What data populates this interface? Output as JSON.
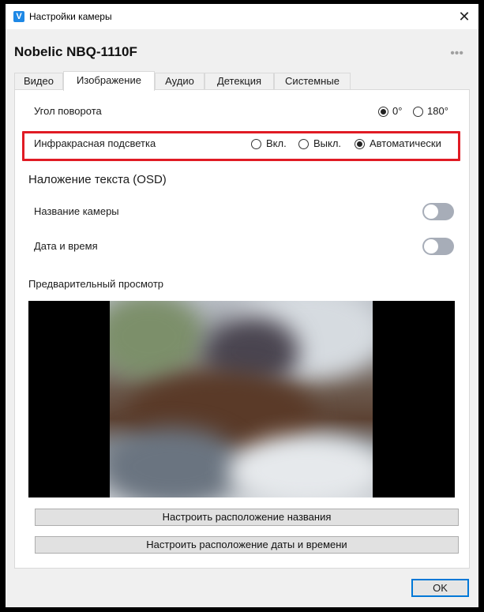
{
  "window": {
    "app_icon": "V",
    "title": "Настройки камеры",
    "close": "✕"
  },
  "device": {
    "name": "Nobelic NBQ-1110F",
    "more": "•••"
  },
  "tabs": [
    {
      "label": "Видео",
      "active": false
    },
    {
      "label": "Изображение",
      "active": true
    },
    {
      "label": "Аудио",
      "active": false
    },
    {
      "label": "Детекция",
      "active": false
    },
    {
      "label": "Системные",
      "active": false
    }
  ],
  "rotation": {
    "label": "Угол поворота",
    "options": [
      {
        "label": "0°",
        "checked": true
      },
      {
        "label": "180°",
        "checked": false
      }
    ]
  },
  "ir": {
    "label": "Инфракрасная подсветка",
    "options": [
      {
        "label": "Вкл.",
        "checked": false
      },
      {
        "label": "Выкл.",
        "checked": false
      },
      {
        "label": "Автоматически",
        "checked": true
      }
    ],
    "highlight_color": "#e01b24"
  },
  "osd": {
    "title": "Наложение текста (OSD)",
    "camera_name_label": "Название камеры",
    "camera_name_on": false,
    "datetime_label": "Дата и время",
    "datetime_on": false
  },
  "preview": {
    "title": "Предварительный просмотр"
  },
  "buttons": {
    "position_name": "Настроить расположение названия",
    "position_datetime": "Настроить расположение даты и времени",
    "ok": "OK"
  },
  "colors": {
    "accent": "#0078d7",
    "toggle_off": "#a7adb8"
  }
}
